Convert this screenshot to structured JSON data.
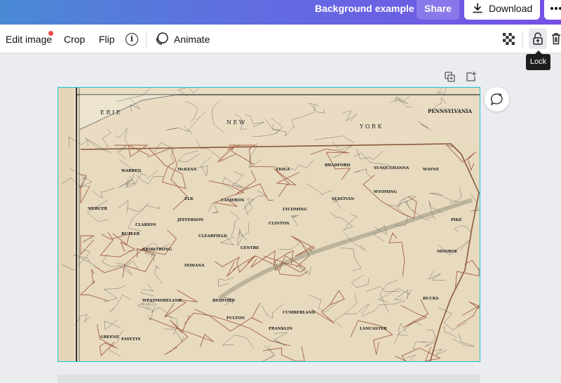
{
  "header": {
    "title": "Background example",
    "share_label": "Share",
    "download_label": "Download"
  },
  "toolbar": {
    "edit_image_label": "Edit image",
    "crop_label": "Crop",
    "flip_label": "Flip",
    "info_label": "i",
    "animate_label": "Animate"
  },
  "tooltip": {
    "label": "Lock"
  },
  "map": {
    "title": "PENNSYLVANIA",
    "top_labels": [
      "E R I E",
      "N E W",
      "Y O R K"
    ],
    "county_labels": [
      "TIOGA",
      "BRADFORD",
      "SUSQUEHANNA",
      "WAYNE",
      "CAMERON",
      "LYCOMING",
      "SULLIVAN",
      "WYOMING",
      "CLEARFIELD",
      "CENTRE",
      "CLINTON",
      "MERCER",
      "CLARION",
      "JEFFERSON",
      "ARMSTRONG",
      "BUTLER",
      "INDIANA",
      "WESTMORELAND",
      "CUMBERLAND",
      "FRANKLIN",
      "BUCKS",
      "MONROE",
      "GREENE",
      "FAYETTE",
      "BEDFORD",
      "FULTON",
      "LANCASTER",
      "PIKE",
      "ELK",
      "WARREN",
      "McKEAN"
    ]
  },
  "colors": {
    "header_gradient_start": "#4a89d4",
    "header_gradient_end": "#7650e6",
    "selection_border": "#19c4d8",
    "notification_dot": "#f04a4a",
    "map_paper": "#e8dcc4"
  },
  "icons": [
    "download-icon",
    "more-icon",
    "info-icon",
    "animate-icon",
    "transparency-icon",
    "lock-icon",
    "trash-icon",
    "copy-page-icon",
    "add-page-icon",
    "comment-icon"
  ]
}
